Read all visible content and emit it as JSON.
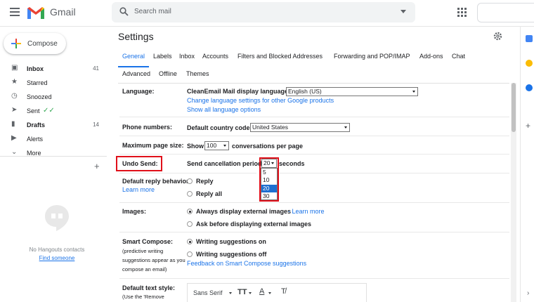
{
  "header": {
    "app_name": "Gmail",
    "search_placeholder": "Search mail"
  },
  "sidebar": {
    "compose_label": "Compose",
    "items": [
      {
        "label": "Inbox",
        "count": "41",
        "icon": "inbox-icon",
        "bold": true
      },
      {
        "label": "Starred",
        "count": "",
        "icon": "star-icon",
        "bold": false
      },
      {
        "label": "Snoozed",
        "count": "",
        "icon": "clock-icon",
        "bold": false
      },
      {
        "label": "Sent",
        "count": "",
        "icon": "send-icon",
        "bold": false
      },
      {
        "label": "Drafts",
        "count": "14",
        "icon": "draft-icon",
        "bold": true
      },
      {
        "label": "Alerts",
        "count": "",
        "icon": "label-icon",
        "bold": false
      },
      {
        "label": "More",
        "count": "",
        "icon": "chevron-down-icon",
        "bold": false
      }
    ],
    "hangouts_empty": "No Hangouts contacts",
    "hangouts_link": "Find someone"
  },
  "settings": {
    "title": "Settings",
    "tabs_row1": [
      "General",
      "Labels",
      "Inbox",
      "Accounts",
      "Filters and Blocked Addresses",
      "Forwarding and POP/IMAP",
      "Add-ons",
      "Chat"
    ],
    "tabs_row2": [
      "Advanced",
      "Offline",
      "Themes"
    ],
    "language": {
      "label": "Language:",
      "display_label": "CleanEmail Mail display language:",
      "value": "English (US)",
      "link1": "Change language settings for other Google products",
      "link2": "Show all language options"
    },
    "phone": {
      "label": "Phone numbers:",
      "code_label": "Default country code:",
      "value": "United States"
    },
    "page_size": {
      "label": "Maximum page size:",
      "show": "Show",
      "value": "100",
      "suffix": "conversations per page"
    },
    "undo_send": {
      "label": "Undo Send:",
      "period_label": "Send cancellation period:",
      "value": "20",
      "suffix": "seconds",
      "options": [
        "5",
        "10",
        "20",
        "30"
      ],
      "selected_index": 2
    },
    "reply": {
      "label": "Default reply behavior:",
      "learn_more": "Learn more",
      "opt1": "Reply",
      "opt2": "Reply all"
    },
    "images": {
      "label": "Images:",
      "opt1": "Always display external images",
      "opt1_link": "- Learn more",
      "opt2": "Ask before displaying external images"
    },
    "smart_compose": {
      "label": "Smart Compose:",
      "sub": "(predictive writing suggestions appear as you compose an email)",
      "opt1": "Writing suggestions on",
      "opt2": "Writing suggestions off",
      "feedback": "Feedback on Smart Compose suggestions"
    },
    "text_style": {
      "label": "Default text style:",
      "sub": "(Use the 'Remove",
      "font": "Sans Serif"
    }
  },
  "colors": {
    "accent": "#1a73e8",
    "highlight_red": "#e0101a",
    "selected_option": "#1e6fd0"
  }
}
